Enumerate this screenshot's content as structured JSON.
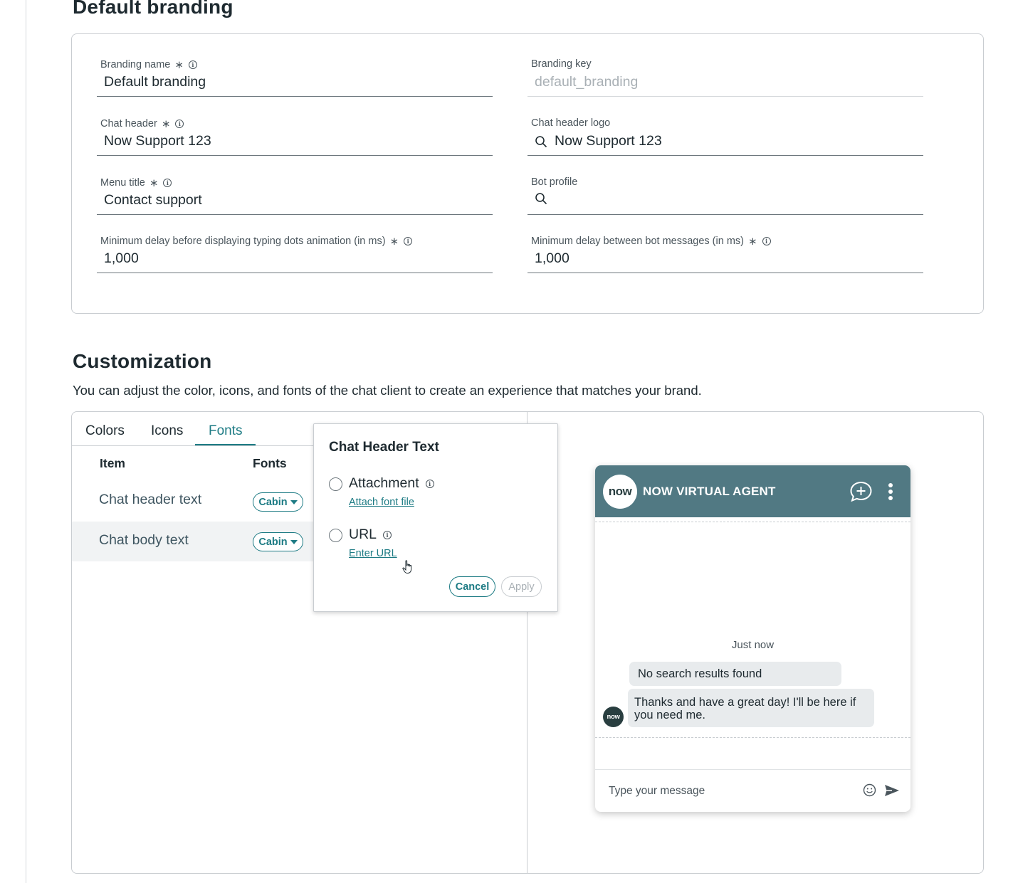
{
  "default_branding": {
    "title": "Default branding",
    "fields": {
      "branding_name": {
        "label": "Branding name",
        "required": "∗",
        "value": "Default branding"
      },
      "branding_key": {
        "label": "Branding key",
        "value": "default_branding"
      },
      "chat_header": {
        "label": "Chat header",
        "required": "∗",
        "value": "Now Support 123"
      },
      "chat_header_logo": {
        "label": "Chat header logo",
        "value": "Now Support 123"
      },
      "menu_title": {
        "label": "Menu title",
        "required": "∗",
        "value": "Contact support"
      },
      "bot_profile": {
        "label": "Bot profile",
        "value": ""
      },
      "typing_delay": {
        "label": "Minimum delay before displaying typing dots animation (in ms)",
        "required": "∗",
        "value": "1,000"
      },
      "bot_message_delay": {
        "label": "Minimum delay between bot messages (in ms)",
        "required": "∗",
        "value": "1,000"
      }
    }
  },
  "customization": {
    "title": "Customization",
    "description": "You can adjust the color, icons, and fonts of the chat client to create an experience that matches your brand.",
    "tabs": [
      {
        "label": "Colors",
        "active": false
      },
      {
        "label": "Icons",
        "active": false
      },
      {
        "label": "Fonts",
        "active": true
      }
    ],
    "table": {
      "headers": [
        "Item",
        "Fonts"
      ],
      "rows": [
        {
          "item": "Chat header text",
          "font": "Cabin"
        },
        {
          "item": "Chat body text",
          "font": "Cabin"
        }
      ]
    }
  },
  "popover": {
    "title": "Chat Header Text",
    "options": [
      {
        "label": "Attachment",
        "link": "Attach font file"
      },
      {
        "label": "URL",
        "link": "Enter URL"
      }
    ],
    "cancel": "Cancel",
    "apply": "Apply"
  },
  "chat_preview": {
    "logo_text": "now",
    "title": "NOW VIRTUAL AGENT",
    "timestamp": "Just now",
    "messages": [
      "No search results found",
      "Thanks and have a great day! I'll be here if you need me."
    ],
    "input_placeholder": "Type your message",
    "header_color": "#517983"
  },
  "colors": {
    "accent": "#1d7b84"
  }
}
